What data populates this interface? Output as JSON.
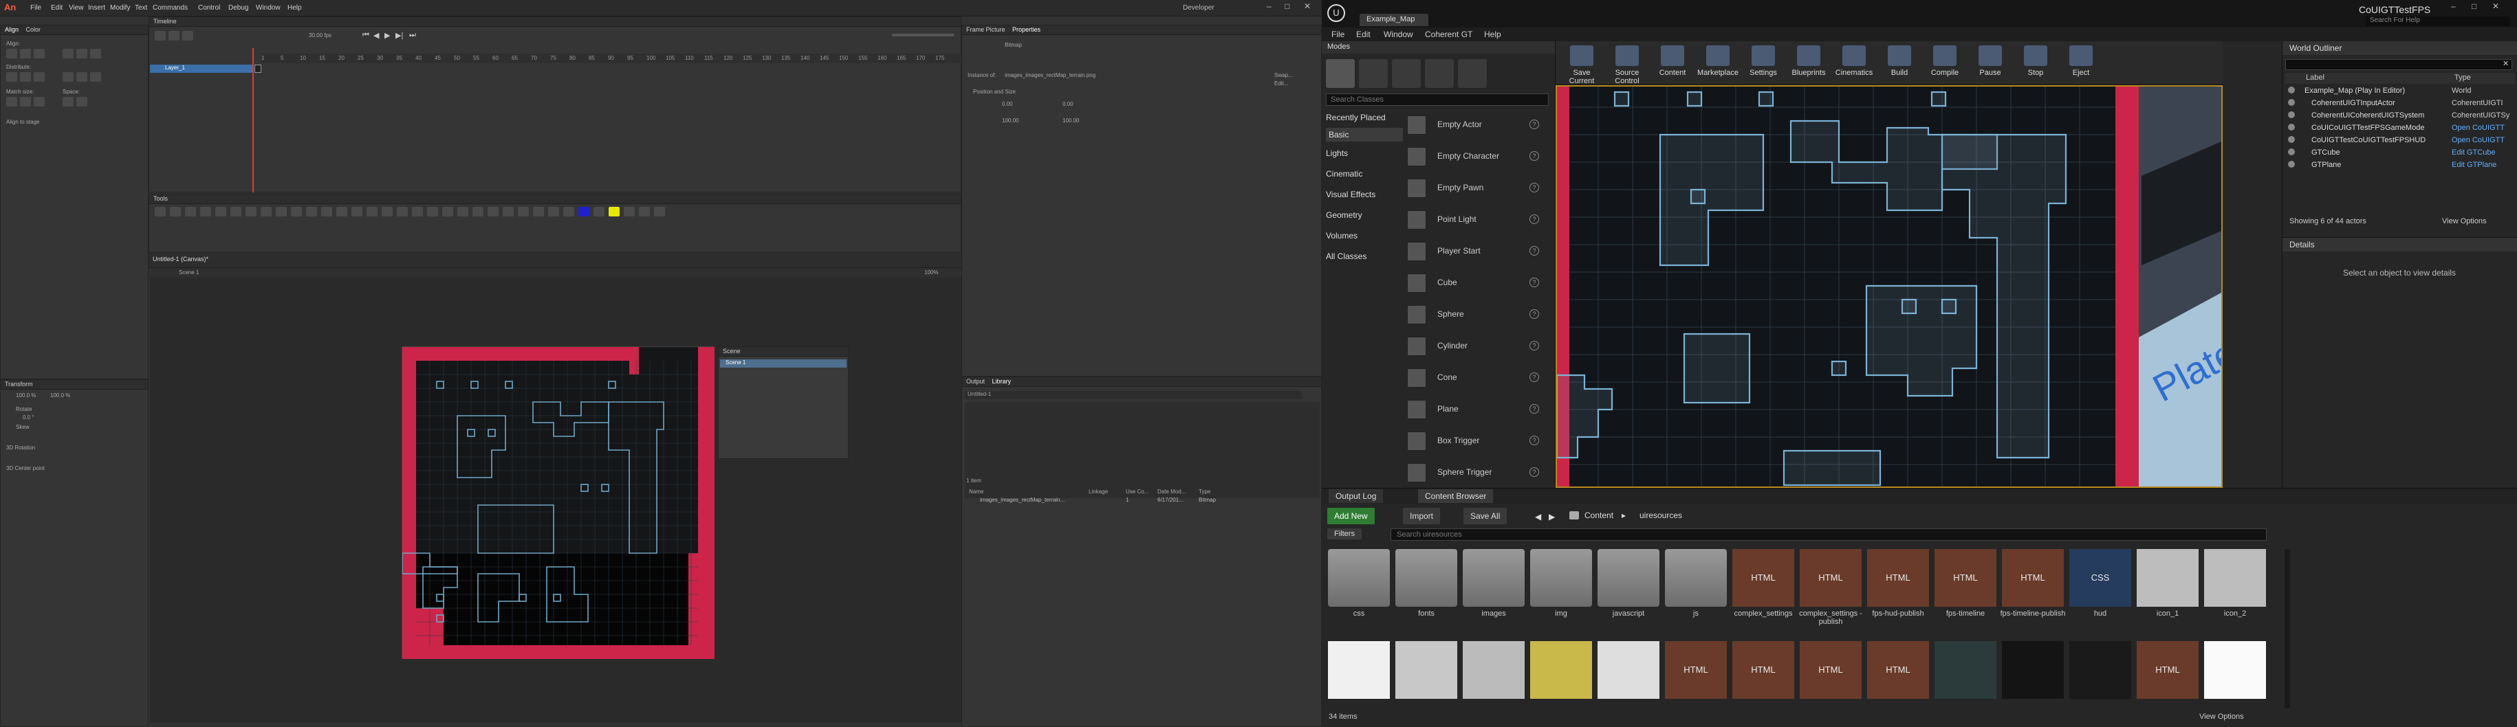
{
  "animate": {
    "logo": "An",
    "menu": [
      "File",
      "Edit",
      "View",
      "Insert",
      "Modify",
      "Text",
      "Commands",
      "Control",
      "Debug",
      "Window",
      "Help"
    ],
    "workspace": "Developer",
    "align_tabs": [
      "Align",
      "Color"
    ],
    "align_labels": {
      "align": "Align:",
      "distribute": "Distribute:",
      "match_size": "Match size:",
      "space": "Space:",
      "to_stage": "Align to stage"
    },
    "timeline_title": "Timeline",
    "layer_name": "Layer_1",
    "fps": "30.00 fps",
    "frame_numbers": [
      "1",
      "5",
      "10",
      "15",
      "20",
      "25",
      "30",
      "35",
      "40",
      "45",
      "50",
      "55",
      "60",
      "65",
      "70",
      "75",
      "80",
      "85",
      "90",
      "95",
      "100",
      "105",
      "110",
      "115",
      "120",
      "125",
      "130",
      "135",
      "140",
      "145",
      "150",
      "155",
      "160",
      "165",
      "170",
      "175"
    ],
    "tools_title": "Tools",
    "stage_tab": "Untitled-1 (Canvas)*",
    "scene": "Scene 1",
    "zoom": "100%",
    "properties_tabs": [
      "Frame Picture",
      "Properties"
    ],
    "properties": {
      "type": "Bitmap",
      "name_label": "Instance of:",
      "instance": "images_images_rectMap_terrain.png",
      "swap": "Swap...",
      "edit": "Edit...",
      "section_pos": "Position and Size",
      "x": "0.00",
      "y": "0.00",
      "w": "100.00",
      "h": "100.00"
    },
    "scene_panel": {
      "title": "Scene",
      "item": "Scene 1"
    },
    "library_tabs": [
      "Output",
      "Library"
    ],
    "library_doc": "Untitled-1",
    "library_items_count": "1 item",
    "library_cols": [
      "Name",
      "Linkage",
      "Use Co...",
      "Date Mod...",
      "Type"
    ],
    "library_row": {
      "name": "images_images_rectMap_terrain...",
      "use": "1",
      "date": "6/17/201...",
      "type": "Bitmap"
    },
    "transform_title": "Transform",
    "transform": {
      "w": "100.0 %",
      "h": "100.0 %",
      "rotate": "Rotate",
      "skew": "Skew",
      "rot_val": "0.0 °",
      "r3d": "3D Rotation",
      "c3d": "3D Center point"
    }
  },
  "unreal": {
    "title_tab": "Example_Map",
    "window_title": "CoUIGTTestFPS",
    "search_help": "Search For Help",
    "menu": [
      "File",
      "Edit",
      "Window",
      "Coherent GT",
      "Help"
    ],
    "modes_title": "Modes",
    "search_classes": "Search Classes",
    "categories": [
      "Recently Placed",
      "Basic",
      "Lights",
      "Cinematic",
      "Visual Effects",
      "Geometry",
      "Volumes",
      "All Classes"
    ],
    "actors": [
      "Empty Actor",
      "Empty Character",
      "Empty Pawn",
      "Point Light",
      "Player Start",
      "Cube",
      "Sphere",
      "Cylinder",
      "Cone",
      "Plane",
      "Box Trigger",
      "Sphere Trigger"
    ],
    "toolbar": [
      "Save Current",
      "Source Control",
      "Content",
      "Marketplace",
      "Settings",
      "Blueprints",
      "Cinematics",
      "Build",
      "Compile",
      "Pause",
      "Stop",
      "Eject"
    ],
    "viewport_text": "Plate",
    "outliner": {
      "title": "World Outliner",
      "col_label": "Label",
      "col_type": "Type",
      "rows": [
        {
          "label": "Example_Map (Play In Editor)",
          "type": "World"
        },
        {
          "label": "CoherentUIGTInputActor",
          "type": "CoherentUIGTI"
        },
        {
          "label": "CoherentUICoherentUIGTSystem",
          "type": "CoherentUIGTSy"
        },
        {
          "label": "CoUICoUIGTTestFPSGameMode",
          "type": "Open CoUIGTT"
        },
        {
          "label": "CoUIGTTestCoUIGTTestFPSHUD",
          "type": "Open CoUIGTT"
        },
        {
          "label": "GTCube",
          "type": "Edit GTCube"
        },
        {
          "label": "GTPlane",
          "type": "Edit GTPlane"
        }
      ],
      "status": "Showing 6 of 44 actors",
      "view_options": "View Options"
    },
    "details": {
      "title": "Details",
      "empty": "Select an object to view details"
    },
    "bottom_tabs": [
      "Output Log",
      "Content Browser"
    ],
    "cb": {
      "add_new": "Add New",
      "import": "Import",
      "save_all": "Save All",
      "path": [
        "Content",
        "uiresources"
      ],
      "filters": "Filters",
      "search": "Search uiresources",
      "row1": [
        {
          "name": "css",
          "kind": "folder"
        },
        {
          "name": "fonts",
          "kind": "folder"
        },
        {
          "name": "images",
          "kind": "folder"
        },
        {
          "name": "img",
          "kind": "folder"
        },
        {
          "name": "javascript",
          "kind": "folder"
        },
        {
          "name": "js",
          "kind": "folder"
        },
        {
          "name": "complex_settings",
          "kind": "html",
          "badge": "HTML"
        },
        {
          "name": "complex_settings -publish",
          "kind": "html",
          "badge": "HTML"
        },
        {
          "name": "fps-hud-publish",
          "kind": "html",
          "badge": "HTML"
        },
        {
          "name": "fps-timeline",
          "kind": "html",
          "badge": "HTML"
        },
        {
          "name": "fps-timeline-publish",
          "kind": "html",
          "badge": "HTML"
        },
        {
          "name": "hud",
          "kind": "css",
          "badge": "CSS"
        },
        {
          "name": "icon_1",
          "kind": "pic"
        },
        {
          "name": "icon_2",
          "kind": "pic"
        }
      ],
      "row2_badges": [
        "",
        "",
        "",
        "",
        "",
        "HTML",
        "HTML",
        "HTML",
        "HTML",
        "",
        "",
        "",
        "HTML",
        ""
      ],
      "count": "34 items",
      "view_options": "View Options"
    }
  }
}
